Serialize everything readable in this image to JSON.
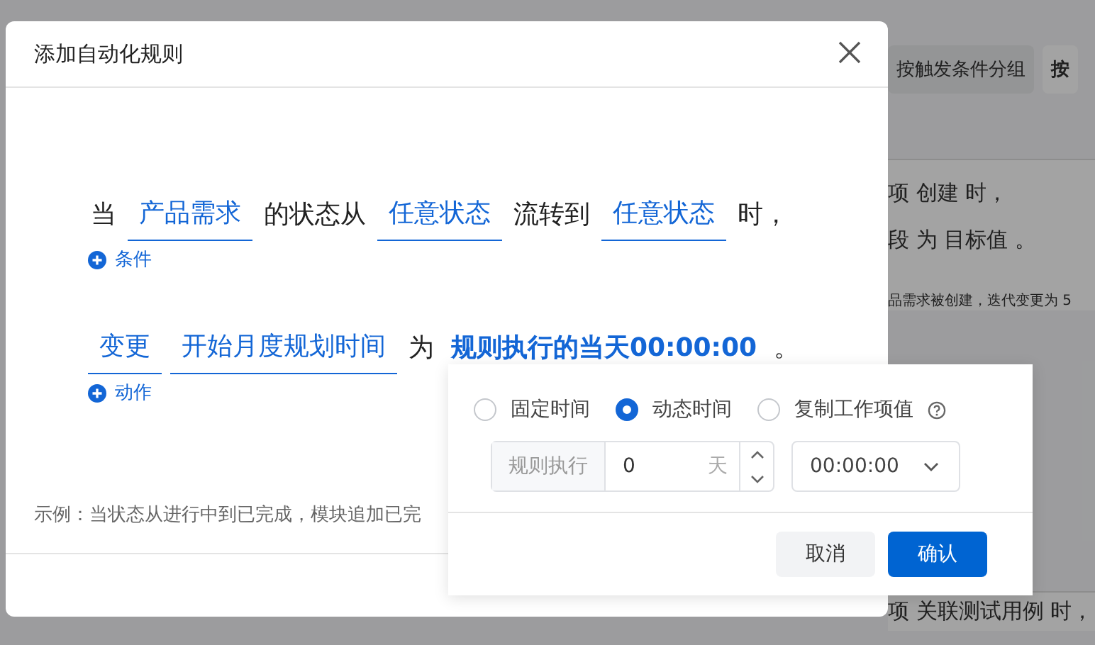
{
  "background": {
    "toolbar": [
      {
        "label": "按触发条件分组",
        "selected": true
      },
      {
        "label": "按",
        "selected": false
      }
    ],
    "card_lines": [
      {
        "kind": "strong",
        "text": "项 创建 时，"
      },
      {
        "kind": "strong",
        "text": "段 为 目标值 。"
      },
      {
        "kind": "small",
        "text": "品需求被创建，迭代变更为 5"
      }
    ],
    "card2_lines": [
      {
        "kind": "strong",
        "text": "项 关联测试用例 时，"
      }
    ]
  },
  "dialog": {
    "title": "添加自动化规则",
    "trigger": [
      {
        "kind": "text",
        "text": "当"
      },
      {
        "kind": "select",
        "text": "产品需求"
      },
      {
        "kind": "text",
        "text": "的状态从"
      },
      {
        "kind": "select",
        "text": "任意状态"
      },
      {
        "kind": "text",
        "text": "流转到"
      },
      {
        "kind": "select",
        "text": "任意状态"
      },
      {
        "kind": "text",
        "text": "时，"
      }
    ],
    "add_condition": "条件",
    "action": [
      {
        "kind": "select",
        "text": "变更"
      },
      {
        "kind": "select",
        "text": "开始月度规划时间"
      },
      {
        "kind": "text",
        "text": "为"
      },
      {
        "kind": "value",
        "text": "规则执行的当天00:00:00"
      },
      {
        "kind": "text",
        "text": "。"
      }
    ],
    "add_action": "动作",
    "example": "示例：当状态从进行中到已完成，模块追加已完"
  },
  "popover": {
    "modes": [
      {
        "label": "固定时间",
        "selected": false,
        "help": false
      },
      {
        "label": "动态时间",
        "selected": true,
        "help": false
      },
      {
        "label": "复制工作项值",
        "selected": false,
        "help": true
      }
    ],
    "offset_prefix": "规则执行",
    "offset_value": "0",
    "offset_unit": "天",
    "time": "00:00:00",
    "buttons": [
      {
        "label": "取消",
        "kind": "secondary"
      },
      {
        "label": "确认",
        "kind": "primary"
      }
    ]
  }
}
